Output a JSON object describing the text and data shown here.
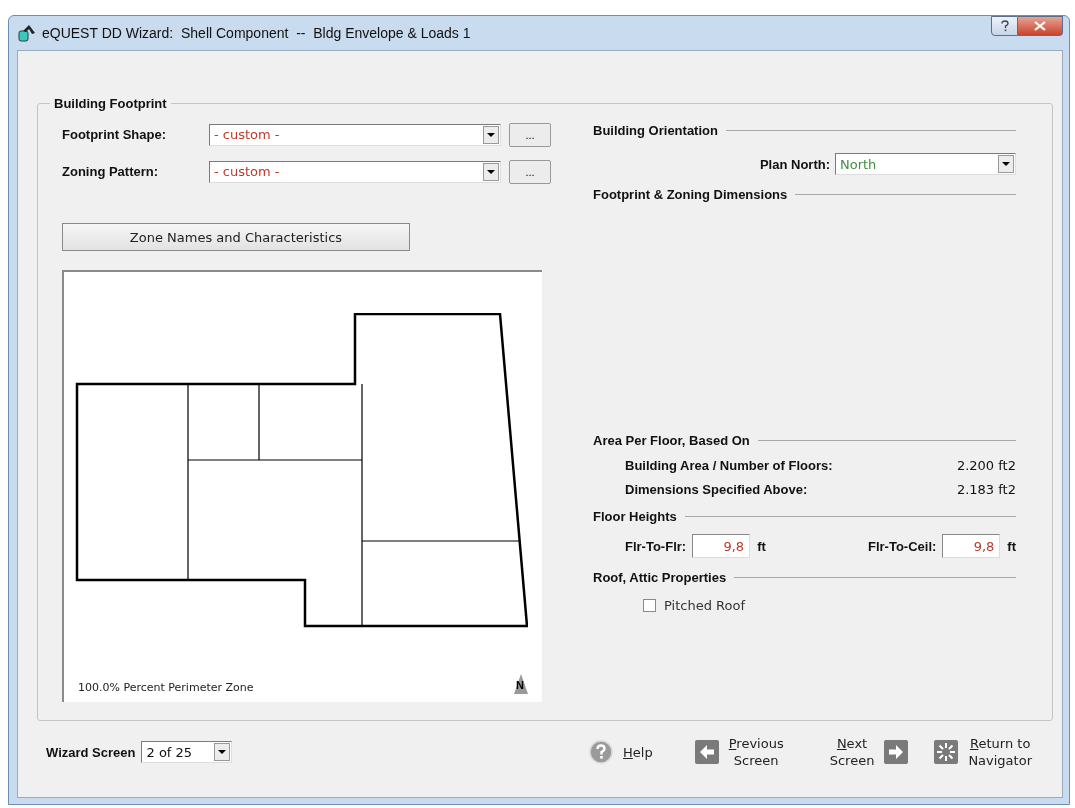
{
  "window": {
    "title": "eQUEST DD Wizard:  Shell Component  --  Bldg Envelope & Loads 1"
  },
  "building_footprint": {
    "title": "Building Footprint",
    "selects": [
      {
        "label": "Footprint Shape:",
        "value": "- custom -",
        "browse": "..."
      },
      {
        "label": "Zoning Pattern:",
        "value": "- custom -",
        "browse": "..."
      }
    ],
    "zone_button": "Zone Names and Characteristics",
    "plan": {
      "caption": "100.0% Percent Perimeter Zone",
      "north_label": "N"
    }
  },
  "orientation": {
    "title": "Building Orientation",
    "label": "Plan North:",
    "value": "North"
  },
  "dimensions": {
    "title": "Footprint & Zoning Dimensions"
  },
  "area": {
    "title": "Area Per Floor, Based On",
    "rows": [
      {
        "label": "Building Area / Number of Floors:",
        "value": "2.200 ft2"
      },
      {
        "label": "Dimensions Specified Above:",
        "value": "2.183 ft2"
      }
    ]
  },
  "floor_heights": {
    "title": "Floor Heights",
    "fields": [
      {
        "label": "Flr-To-Flr:",
        "value": "9,8",
        "unit": "ft"
      },
      {
        "label": "Flr-To-Ceil:",
        "value": "9,8",
        "unit": "ft"
      }
    ]
  },
  "roof": {
    "title": "Roof, Attic Properties",
    "checkboxes": [
      {
        "label": "Pitched Roof",
        "checked": false
      }
    ]
  },
  "footer": {
    "wizard_label": "Wizard Screen",
    "wizard_value": "2 of 25",
    "buttons": [
      {
        "kind": "help",
        "label": "Help"
      },
      {
        "kind": "previous",
        "label": "Previous\nScreen"
      },
      {
        "kind": "next",
        "label": "Next\nScreen"
      },
      {
        "kind": "navigator",
        "label": "Return to\nNavigator"
      }
    ]
  }
}
